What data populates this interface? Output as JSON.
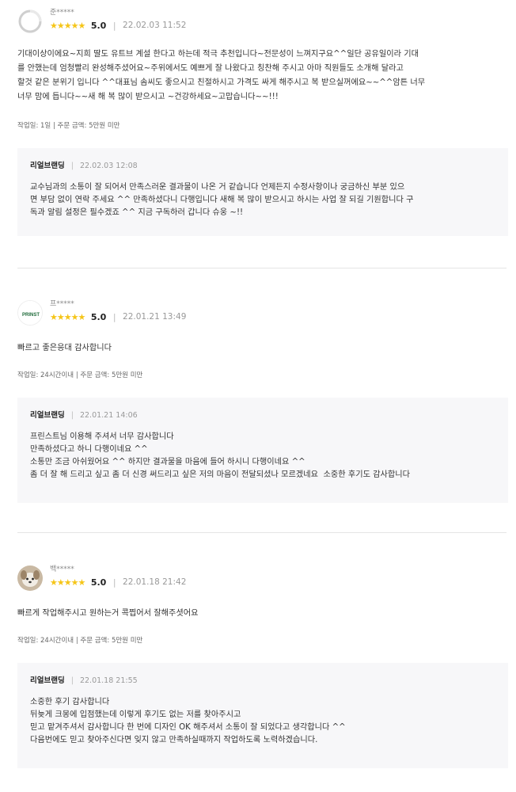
{
  "reviews": [
    {
      "name": "준*****",
      "avatar_icon": "default-avatar-icon",
      "stars": "★★★★★",
      "score": "5.0",
      "separator": "|",
      "date": "22.02.03 11:52",
      "body": "기대이상이에요~지희 딸도 유트브 계설 한다고 하는데 적극 추천입니다~전문성이 느껴지구요^^일단 공유일이라 기대\n를 안했는데 엄청빨리 완성해주셨어요~주위에서도 예쁘게 잘 나왔다고 칭찬해 주시고 아마 직원들도 소개해 달라고\n할것 같은 분위기 입니다 ^^대표님 솜씨도 좋으시고 친절하시고 가격도 싸게 해주시고 복 받으실꺼에요~~^^암튼 너무\n너무 맘에 듭니다~~새 해 복 많이 받으시고 ~건강하세요~고맙습니다~~!!!",
      "meta": "작업일: 1일 | 주문 금액: 5만원 미만",
      "reply": {
        "author": "리얼브랜딩",
        "separator": "|",
        "date": "22.02.03 12:08",
        "text": "교수님과의 소통이 잘 되어서 만족스러운 결과물이 나온 거 같습니다 언제든지 수정사항이나 궁금하신 부분 있으\n면 부담 없이 연락 주세요 ^^ 만족하셨다니 다행입니다 새해 복 많이 받으시고 하시는 사업 잘 되길 기원합니다 구\n독과 알림 설정은 필수겠죠 ^^ 지금 구독하러 갑니다 슈웅 ~!!"
      }
    },
    {
      "name": "프*****",
      "avatar_icon": "printst-logo-icon",
      "avatar_logo_text": "PRINST",
      "stars": "★★★★★",
      "score": "5.0",
      "separator": "|",
      "date": "22.01.21 13:49",
      "body": "빠르고 좋은응대 감사합니다",
      "meta": "작업일: 24시간이내 | 주문 금액: 5만원 미만",
      "reply": {
        "author": "리얼브랜딩",
        "separator": "|",
        "date": "22.01.21 14:06",
        "text": "프린스트님 이용해 주셔서 너무 감사합니다\n만족하셨다고 하니 다행이네요 ^^\n소통만 조금 아쉬웠어요 ^^ 하지만 결과물을 마음에 들어 하시니 다행이네요 ^^\n좀 더 잘 해 드리고 싶고 좀 더 신경 써드리고 싶은 저의 마음이 전달되셨나 모르겠네요  소중한 후기도 감사합니다"
      }
    },
    {
      "name": "백*****",
      "avatar_icon": "dog-photo-avatar-icon",
      "stars": "★★★★★",
      "score": "5.0",
      "separator": "|",
      "date": "22.01.18 21:42",
      "body": "빠르게 작업해주시고 원하는거 콕찝어서 잘해주셧어요",
      "meta": "작업일: 24시간이내 | 주문 금액: 5만원 미만",
      "reply": {
        "author": "리얼브랜딩",
        "separator": "|",
        "date": "22.01.18 21:55",
        "text": "소중한 후기 감사합니다\n뒤늦게 크몽에 입점했는데 이렇게 후기도 없는 저를 찾아주시고\n믿고 맡겨주셔서 감사합니다 한 번에 디자인 OK 해주셔서 소통이 잘 되었다고 생각합니다 ^^\n다음번에도 믿고 찾아주신다면 잊지 않고 만족하실때까지 작업하도록 노력하겠습니다."
      }
    }
  ],
  "colors": {
    "star": "#f5c518",
    "reply_bg": "#f7f7f9",
    "divider": "#e5e5e5"
  }
}
